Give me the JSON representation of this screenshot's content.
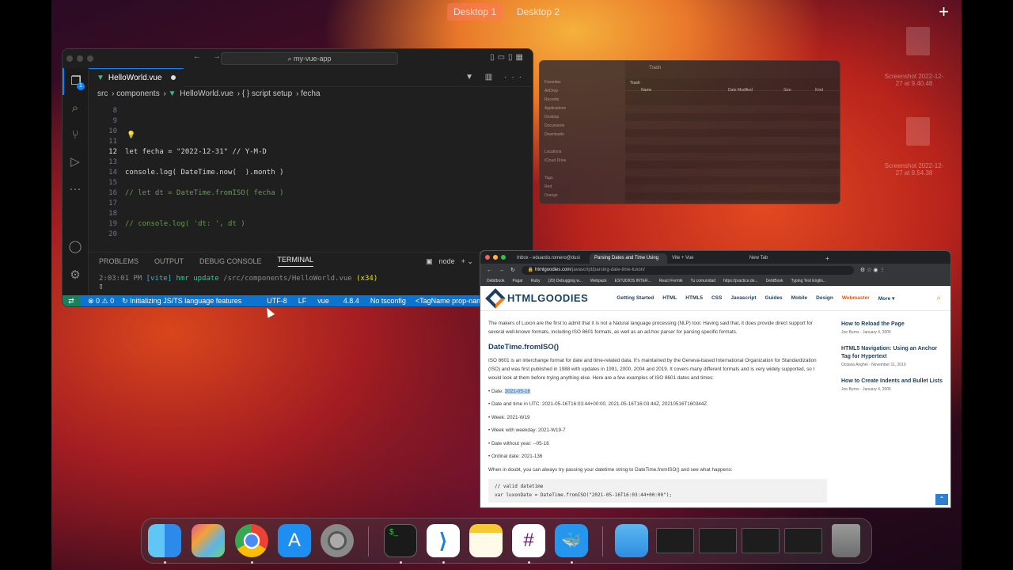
{
  "desktops": [
    "Desktop 1",
    "Desktop 2"
  ],
  "vscode": {
    "search": "my-vue-app",
    "tab": "HelloWorld.vue",
    "explorer_badge": "1",
    "breadcrumb": [
      "src",
      "components",
      "HelloWorld.vue",
      "{ } script setup",
      "fecha"
    ],
    "lines": [
      {
        "n": "8",
        "t": ""
      },
      {
        "n": "9",
        "t": ""
      },
      {
        "n": "10",
        "t": ""
      },
      {
        "n": "11",
        "t": ""
      },
      {
        "n": "12",
        "t": "let fecha = \"2022-12-31\" // Y-M-D"
      },
      {
        "n": "13",
        "t": ""
      },
      {
        "n": "14",
        "t": "console.log( DateTime.now(  ).month )"
      },
      {
        "n": "15",
        "t": ""
      },
      {
        "n": "16",
        "t": "// let dt = DateTime.fromISO( fecha )"
      },
      {
        "n": "17",
        "t": ""
      },
      {
        "n": "18",
        "t": ""
      },
      {
        "n": "19",
        "t": "// console.log( 'dt: ', dt )"
      },
      {
        "n": "20",
        "t": ""
      }
    ],
    "panel_tabs": [
      "PROBLEMS",
      "OUTPUT",
      "DEBUG CONSOLE",
      "TERMINAL"
    ],
    "terminal_shell": "node",
    "terminal": {
      "time": "2:03:01 PM",
      "tag": "[vite]",
      "msg": "hmr update",
      "path": "/src/components/HelloWorld.vue",
      "count": "(x34)"
    },
    "status": {
      "problems": "⊗ 0 ⚠ 0",
      "task": "Initializing JS/TS language features",
      "encoding": "UTF-8",
      "eol": "LF",
      "lang": "vue",
      "version": "4.8.4",
      "tsconfig": "No tsconfig",
      "tagname": "<TagName prop-name"
    }
  },
  "finder": {
    "title": "Trash",
    "folder": "Trash",
    "cols": [
      "Name",
      "Date Modified",
      "Size",
      "Kind"
    ],
    "sidebar": [
      "Favorites",
      "AirDrop",
      "Recents",
      "Applications",
      "Desktop",
      "Documents",
      "Downloads",
      "",
      "Locations",
      "iCloud Drive",
      "",
      "Tags",
      "Red",
      "Orange"
    ]
  },
  "chrome": {
    "tabs": [
      "Inbox - eduardo.romero@dusi",
      "Parsing Dates and Time Using",
      "Vite + Vue",
      "New Tab"
    ],
    "url_host": "htmlgoodies.com",
    "url_path": "/javascript/parsing-date-time-luxon/",
    "bookmarks": [
      "Debitbook",
      "Pagar",
      "Ruby",
      "(20) Debugging w...",
      "Webpack",
      "ESTUDIOS INTER...",
      "React Formik",
      "Tu comunidad",
      "https://practice.de...",
      "DebtBook",
      "Typing Text Englis..."
    ],
    "logo": "HTMLGOODIES",
    "nav": [
      "Getting Started",
      "HTML",
      "HTML5",
      "CSS",
      "Javascript",
      "Guides",
      "Mobile",
      "Design",
      "Webmaster",
      "More ▾"
    ],
    "intro": "The makers of Luxon are the first to admit that it is not a Natural language processing (NLP) tool. Having said that, it does provide direct support for several well-known formats, including ISO 8601 formats, as well as an ad-hoc parser for parsing specific formats.",
    "heading": "DateTime.fromISO()",
    "para": "ISO 8601 is an interchange format for date and time-related data. It's maintained by the Geneva-based International Organization for Standardization (ISO) and was first published in 1988 with updates in 1991, 2000, 2004 and 2019. It covers many different formats and is very widely supported, so I would look at them before trying anything else. Here are a few examples of ISO 8601 dates and times:",
    "list": [
      "Date and time in UTC: 2021-05-16T16:03:44+00:00, 2021-05-16T16:03:44Z, 20210516T160344Z",
      "Week: 2021-W19",
      "Week with weekday: 2021-W19-7",
      "Date without year: --05-16",
      "Ordinal date: 2021-136"
    ],
    "date_label": "Date:",
    "date_value": "2021-05-16",
    "doubt": "When in doubt, you can always try passing your datetime string to DateTime.fromISO() and see what happens:",
    "code1": "// valid datetime",
    "code2": "var luxonDate = DateTime.fromISO(\"2021-05-16T16:03:44+00:00\");",
    "aside": [
      {
        "t": "How to Reload the Page",
        "m": "Joe Burns - January 4, 2005"
      },
      {
        "t": "HTML5 Navigation: Using an Anchor Tag for Hypertext",
        "m": "Octavia Anghel - November 11, 2019"
      },
      {
        "t": "How to Create Indents and Bullet Lists",
        "m": "Joe Burns - January 4, 2005"
      }
    ]
  },
  "desktop_labels": [
    "Screenshot 2022-12-27 at 9.40.48",
    "Screenshot 2022-12-27 at 9.54.38"
  ],
  "dock": [
    "Finder",
    "Launchpad",
    "Google Chrome",
    "App Store",
    "System Settings",
    "Terminal",
    "Visual Studio Code",
    "Notes",
    "Slack",
    "Docker",
    "Downloads",
    "Trash"
  ]
}
